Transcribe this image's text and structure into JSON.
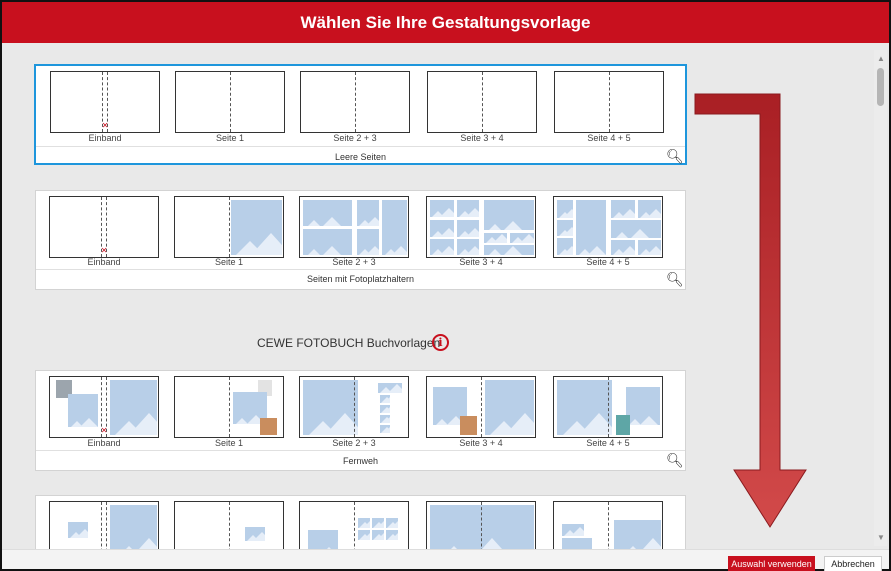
{
  "dialog": {
    "title": "Wählen Sie Ihre Gestaltungsvorlage",
    "confirm_label": "Auswahl verwenden",
    "cancel_label": "Abbrechen"
  },
  "section": {
    "title": "CEWE FOTOBUCH Buchvorlagen"
  },
  "page_labels": [
    "Einband",
    "Seite 1",
    "Seite 2 + 3",
    "Seite 3 + 4",
    "Seite 4 + 5"
  ],
  "templates": [
    {
      "name": "Leere Seiten",
      "selected": true
    },
    {
      "name": "Seiten mit Fotoplatzhaltern",
      "selected": false
    },
    {
      "name": "Fernweh",
      "selected": false
    }
  ],
  "colors": {
    "accent": "#c8101e",
    "selection": "#1e96dc",
    "arrow": "#b5262b"
  },
  "icons": {
    "magnifier": "magnifier-icon",
    "info": "info-icon"
  }
}
